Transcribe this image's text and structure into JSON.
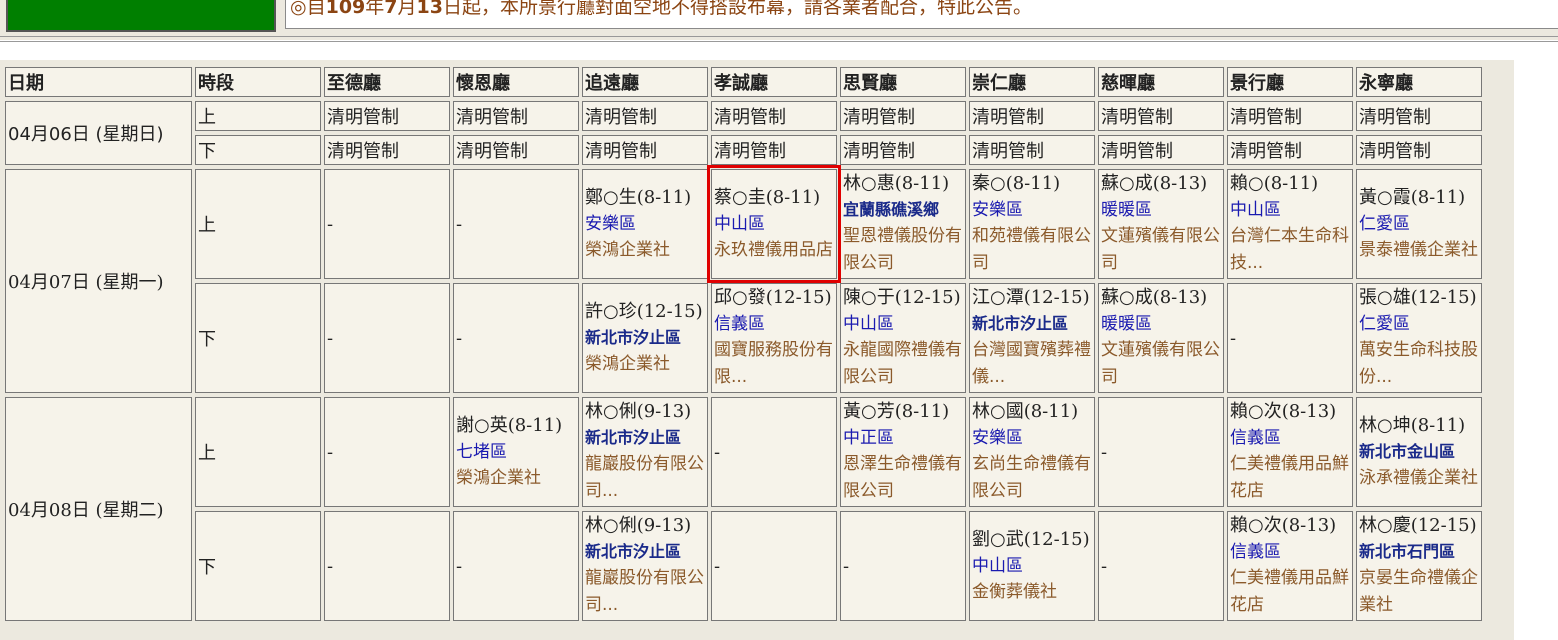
{
  "header": {
    "notice_prefix": "◎自",
    "notice_year": "109",
    "notice_mid1": "年",
    "notice_month": "7",
    "notice_mid2": "月",
    "notice_day": "13",
    "notice_rest": "日起，本所景行廳對面空地不得搭設布幕，請各業者配合，特此公告。"
  },
  "columns": [
    "日期",
    "時段",
    "至德廳",
    "懷恩廳",
    "追遠廳",
    "孝誠廳",
    "思賢廳",
    "崇仁廳",
    "慈暉廳",
    "景行廳",
    "永寧廳"
  ],
  "rows": [
    {
      "date": "04月06日 (星期日)",
      "slots": [
        {
          "slot": "上",
          "cells": [
            "清明管制",
            "清明管制",
            "清明管制",
            "清明管制",
            "清明管制",
            "清明管制",
            "清明管制",
            "清明管制",
            "清明管制"
          ]
        },
        {
          "slot": "下",
          "cells": [
            "清明管制",
            "清明管制",
            "清明管制",
            "清明管制",
            "清明管制",
            "清明管制",
            "清明管制",
            "清明管制",
            "清明管制"
          ]
        }
      ]
    },
    {
      "date": "04月07日 (星期一)",
      "slots": [
        {
          "slot": "上",
          "cells": [
            {
              "empty": "-"
            },
            {
              "empty": "-"
            },
            {
              "name": "鄭○生(8-11)",
              "district": "安樂區",
              "firm": "榮鴻企業社"
            },
            {
              "name": "蔡○圭(8-11)",
              "district": "中山區",
              "firm": "永玖禮儀用品店"
            },
            {
              "name": "林○惠(8-11)",
              "district": "宜蘭縣礁溪鄉",
              "firm": "聖恩禮儀股份有限公司"
            },
            {
              "name": "秦○(8-11)",
              "district": "安樂區",
              "firm": "和苑禮儀有限公司"
            },
            {
              "name": "蘇○成(8-13)",
              "district": "暖暖區",
              "firm": "文蓮殯儀有限公司"
            },
            {
              "name": "賴○(8-11)",
              "district": "中山區",
              "firm": "台灣仁本生命科技..."
            },
            {
              "name": "黃○霞(8-11)",
              "district": "仁愛區",
              "firm": "景泰禮儀企業社"
            }
          ]
        },
        {
          "slot": "下",
          "cells": [
            {
              "empty": "-"
            },
            {
              "empty": "-"
            },
            {
              "name": "許○珍(12-15)",
              "district": "新北市汐止區",
              "firm": "榮鴻企業社"
            },
            {
              "name": "邱○發(12-15)",
              "district": "信義區",
              "firm": "國寶服務股份有限..."
            },
            {
              "name": "陳○于(12-15)",
              "district": "中山區",
              "firm": "永龍國際禮儀有限公司"
            },
            {
              "name": "江○潭(12-15)",
              "district": "新北市汐止區",
              "firm": "台灣國寶殯葬禮儀..."
            },
            {
              "name": "蘇○成(8-13)",
              "district": "暖暖區",
              "firm": "文蓮殯儀有限公司"
            },
            {
              "empty": "-"
            },
            {
              "name": "張○雄(12-15)",
              "district": "仁愛區",
              "firm": "萬安生命科技股份..."
            }
          ]
        }
      ]
    },
    {
      "date": "04月08日 (星期二)",
      "slots": [
        {
          "slot": "上",
          "cells": [
            {
              "empty": "-"
            },
            {
              "name": "謝○英(8-11)",
              "district": "七堵區",
              "firm": "榮鴻企業社"
            },
            {
              "name": "林○俐(9-13)",
              "district": "新北市汐止區",
              "firm": "龍巖股份有限公司..."
            },
            {
              "empty": "-"
            },
            {
              "name": "黃○芳(8-11)",
              "district": "中正區",
              "firm": "恩澤生命禮儀有限公司"
            },
            {
              "name": "林○國(8-11)",
              "district": "安樂區",
              "firm": "玄尚生命禮儀有限公司"
            },
            {
              "empty": "-"
            },
            {
              "name": "賴○次(8-13)",
              "district": "信義區",
              "firm": "仁美禮儀用品鮮花店"
            },
            {
              "name": "林○坤(8-11)",
              "district": "新北市金山區",
              "firm": "泳承禮儀企業社"
            }
          ]
        },
        {
          "slot": "下",
          "cells": [
            {
              "empty": "-"
            },
            {
              "empty": "-"
            },
            {
              "name": "林○俐(9-13)",
              "district": "新北市汐止區",
              "firm": "龍巖股份有限公司..."
            },
            {
              "empty": "-"
            },
            {
              "empty": "-"
            },
            {
              "name": "劉○武(12-15)",
              "district": "中山區",
              "firm": "金衡葬儀社"
            },
            {
              "empty": "-"
            },
            {
              "name": "賴○次(8-13)",
              "district": "信義區",
              "firm": "仁美禮儀用品鮮花店"
            },
            {
              "name": "林○慶(12-15)",
              "district": "新北市石門區",
              "firm": "京晏生命禮儀企業社"
            }
          ]
        }
      ]
    }
  ],
  "highlight": {
    "row": 1,
    "slot": 0,
    "col": 3
  },
  "colors": {
    "green": "#007f00",
    "district": "#1a1ab0",
    "firm": "#8b5a2b",
    "highlight": "#e00000"
  }
}
